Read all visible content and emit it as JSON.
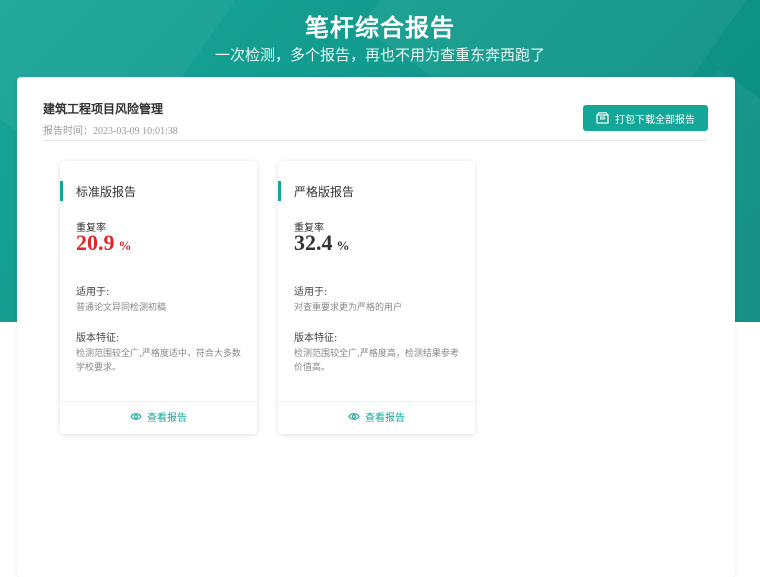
{
  "hero": {
    "title": "笔杆综合报告",
    "subtitle": "一次检测，多个报告，再也不用为查重东奔西跑了"
  },
  "project": {
    "title": "建筑工程项目风险管理",
    "report_time": "报告时间：2023-03-09 10:01:38"
  },
  "toolbar": {
    "download_label": "打包下载全部报告",
    "download_icon": "package-icon"
  },
  "cards": [
    {
      "name": "标准版报告",
      "rate_label": "重复率",
      "rate_value": "20.9",
      "rate_unit": "%",
      "rate_color": "#e0262b",
      "suitable_label": "适用于:",
      "suitable_text": "普通论文异同检测初稿",
      "feature_label": "版本特征:",
      "feature_text": "检测范围较全广,严格度适中，符合大多数学校要求。",
      "view_label": "查看报告",
      "view_icon": "eye-icon"
    },
    {
      "name": "严格版报告",
      "rate_label": "重复率",
      "rate_value": "32.4",
      "rate_unit": "%",
      "rate_color": "#333333",
      "suitable_label": "适用于:",
      "suitable_text": "对查重要求更为严格的用户",
      "feature_label": "版本特征:",
      "feature_text": "检测范围较全广,严格度高，检测结果参考价值高。",
      "view_label": "查看报告",
      "view_icon": "eye-icon"
    }
  ],
  "colors": {
    "brand": "#14a697",
    "hero_bg": "#0f968a",
    "rate_red": "#e0262b"
  }
}
